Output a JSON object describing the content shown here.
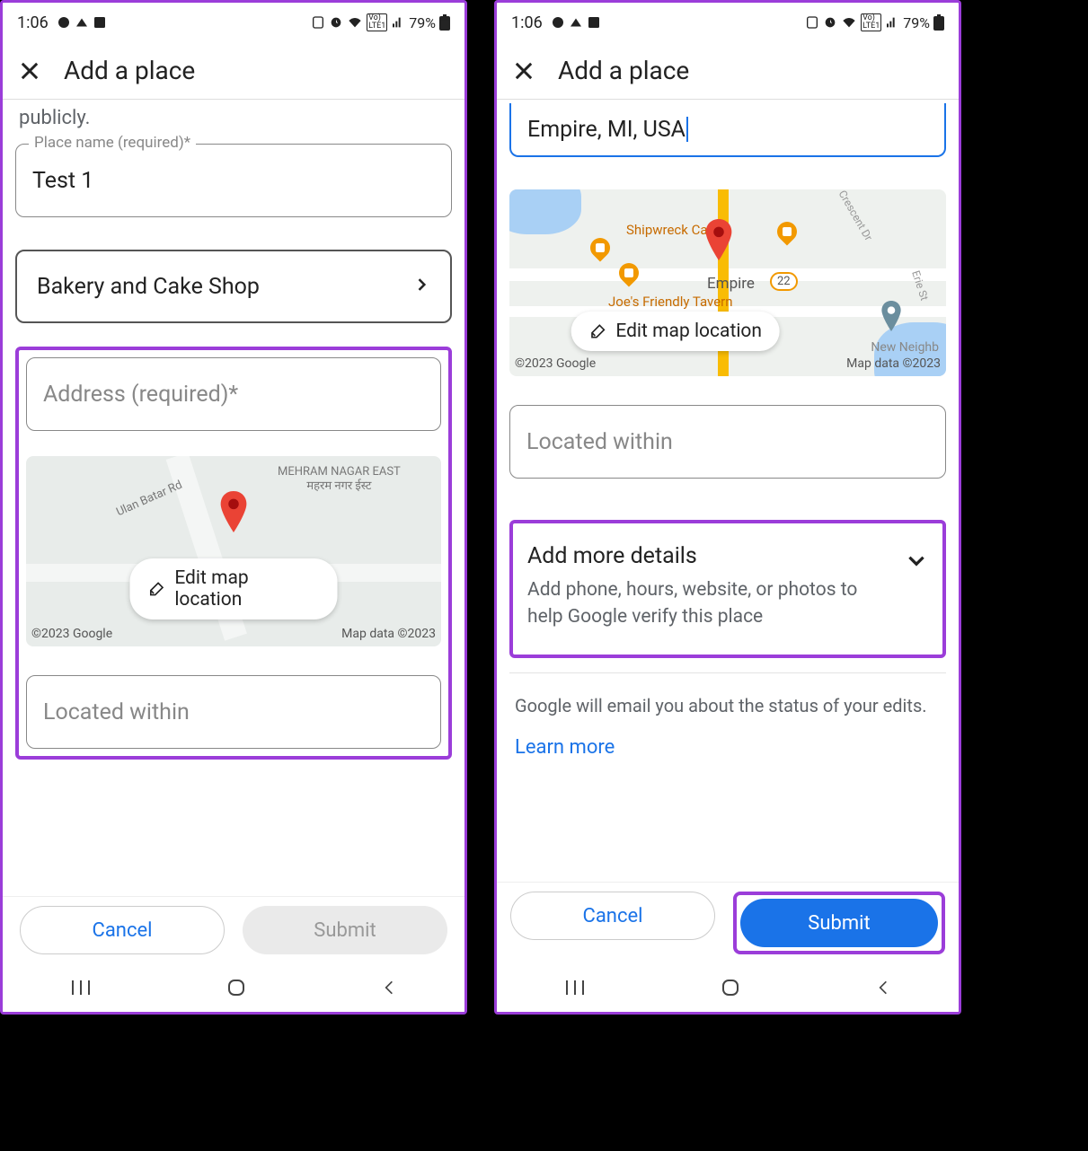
{
  "status": {
    "time": "1:06",
    "battery": "79%"
  },
  "header": {
    "title": "Add a place"
  },
  "left": {
    "intro_fragment": "publicly.",
    "place_name_label": "Place name (required)*",
    "place_name_value": "Test 1",
    "category_value": "Bakery and Cake Shop",
    "address_placeholder": "Address (required)*",
    "edit_map_label": "Edit map location",
    "map_copyright": "©2023 Google",
    "map_data": "Map data ©2023",
    "map_area_label_1": "MEHRAM NAGAR EAST",
    "map_area_label_2": "महरम नगर ईस्ट",
    "map_road_label": "Ulan Batar Rd",
    "located_within_placeholder": "Located within",
    "cancel": "Cancel",
    "submit": "Submit"
  },
  "right": {
    "address_value": "Empire, MI, USA",
    "edit_map_label": "Edit map location",
    "map_copyright": "©2023 Google",
    "map_data": "Map data ©2023",
    "map_poi_1": "Shipwreck Cafe",
    "map_poi_2": "Joe's Friendly Tavern",
    "map_town": "Empire",
    "map_neigh": "New Neighb",
    "map_route": "22",
    "map_street_1": "Crescent Dr",
    "map_street_2": "Erie St",
    "located_within_placeholder": "Located within",
    "more_title": "Add more details",
    "more_sub": "Add phone, hours, website, or photos to help Google verify this place",
    "status_note": "Google will email you about the status of your edits.",
    "learn_more": "Learn more",
    "cancel": "Cancel",
    "submit": "Submit"
  }
}
